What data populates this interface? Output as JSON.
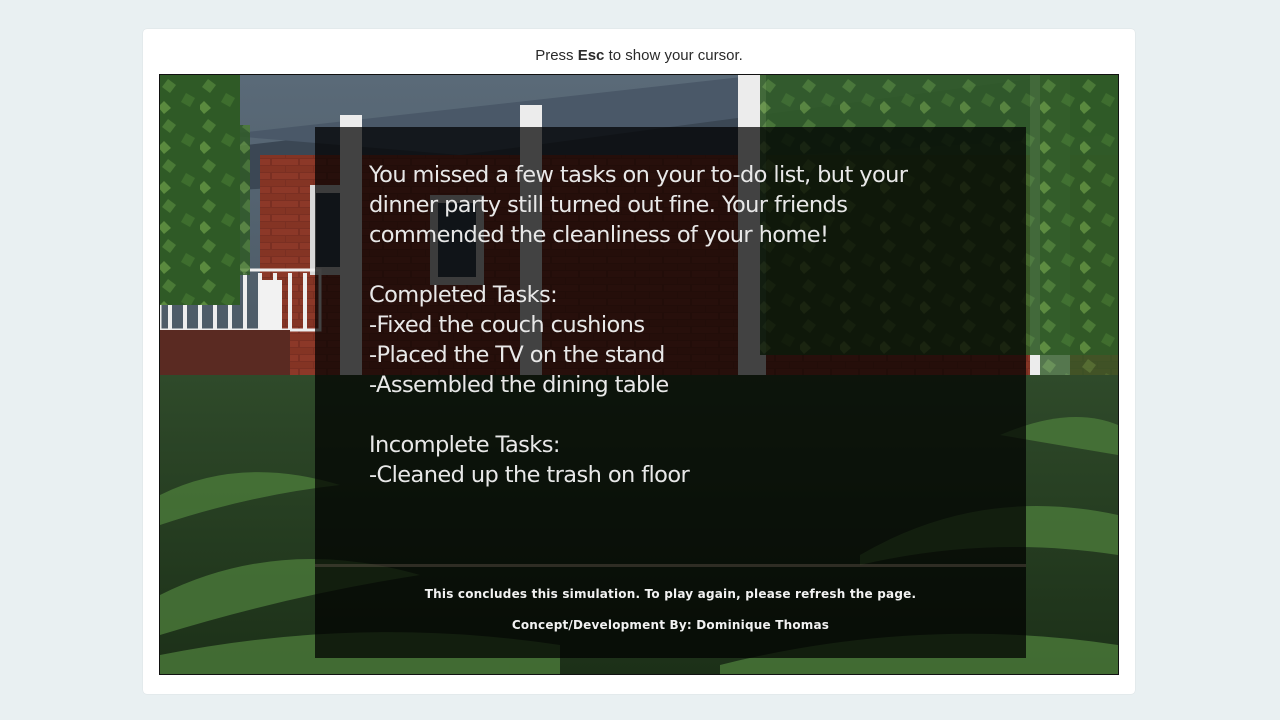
{
  "hint": {
    "prefix": "Press",
    "key": "Esc",
    "suffix": "to show your cursor."
  },
  "result": {
    "summary_lines": [
      "You missed a few tasks on your to-do list, but your",
      "dinner party still turned out fine. Your friends",
      "commended the cleanliness of your home!"
    ],
    "completed_heading": "Completed Tasks:",
    "completed": [
      "-Fixed the couch cushions",
      "-Placed the TV on the stand",
      "-Assembled the dining table"
    ],
    "incomplete_heading": "Incomplete Tasks:",
    "incomplete": [
      "-Cleaned up the trash on floor"
    ]
  },
  "footer": {
    "conclusion": "This concludes this simulation. To play again, please refresh the page.",
    "credits": "Concept/Development By: Dominique Thomas"
  },
  "colors": {
    "page_background": "#e9f0f2",
    "card": "#ffffff",
    "overlay": "rgba(0,0,0,0.72)",
    "text": "#e8e8e8"
  }
}
